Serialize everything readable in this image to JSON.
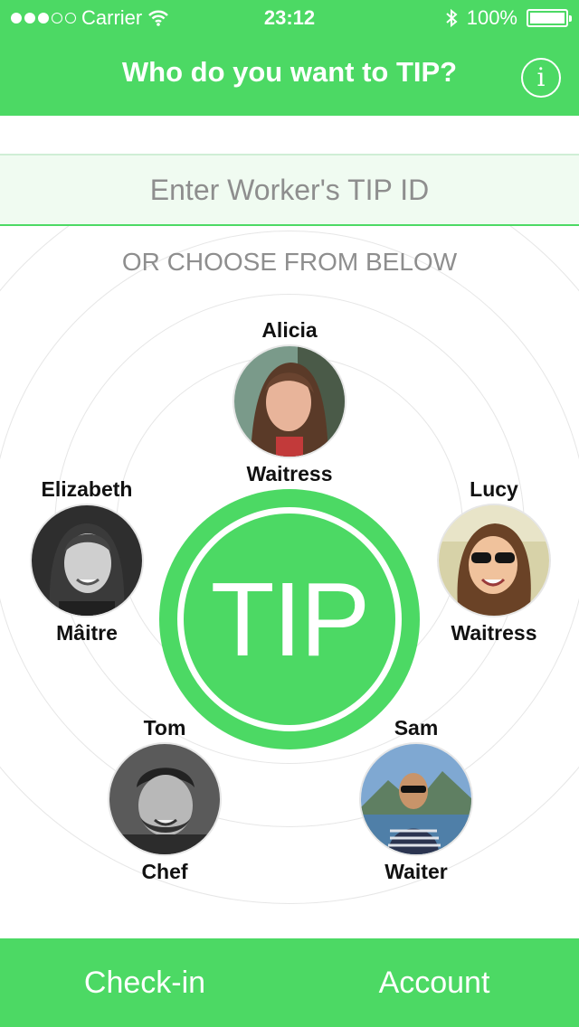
{
  "status_bar": {
    "carrier": "Carrier",
    "time": "23:12",
    "battery": "100%",
    "signal_dots_filled": 3,
    "signal_dots_total": 5
  },
  "header": {
    "title": "Who do you want to TIP?",
    "info_icon": "info-icon"
  },
  "search": {
    "placeholder": "Enter Worker's TIP ID"
  },
  "choose_label": "OR CHOOSE FROM BELOW",
  "workers": [
    {
      "name": "Alicia",
      "role": "Waitress"
    },
    {
      "name": "Elizabeth",
      "role": "Mâitre"
    },
    {
      "name": "Lucy",
      "role": "Waitress"
    },
    {
      "name": "Tom",
      "role": "Chef"
    },
    {
      "name": "Sam",
      "role": "Waiter"
    }
  ],
  "tip_button": {
    "label": "TIP"
  },
  "tabs": {
    "checkin": "Check-in",
    "account": "Account"
  },
  "colors": {
    "accent": "#4cd964",
    "ring": "#e6e6e6",
    "muted_text": "#8e8e8e"
  }
}
